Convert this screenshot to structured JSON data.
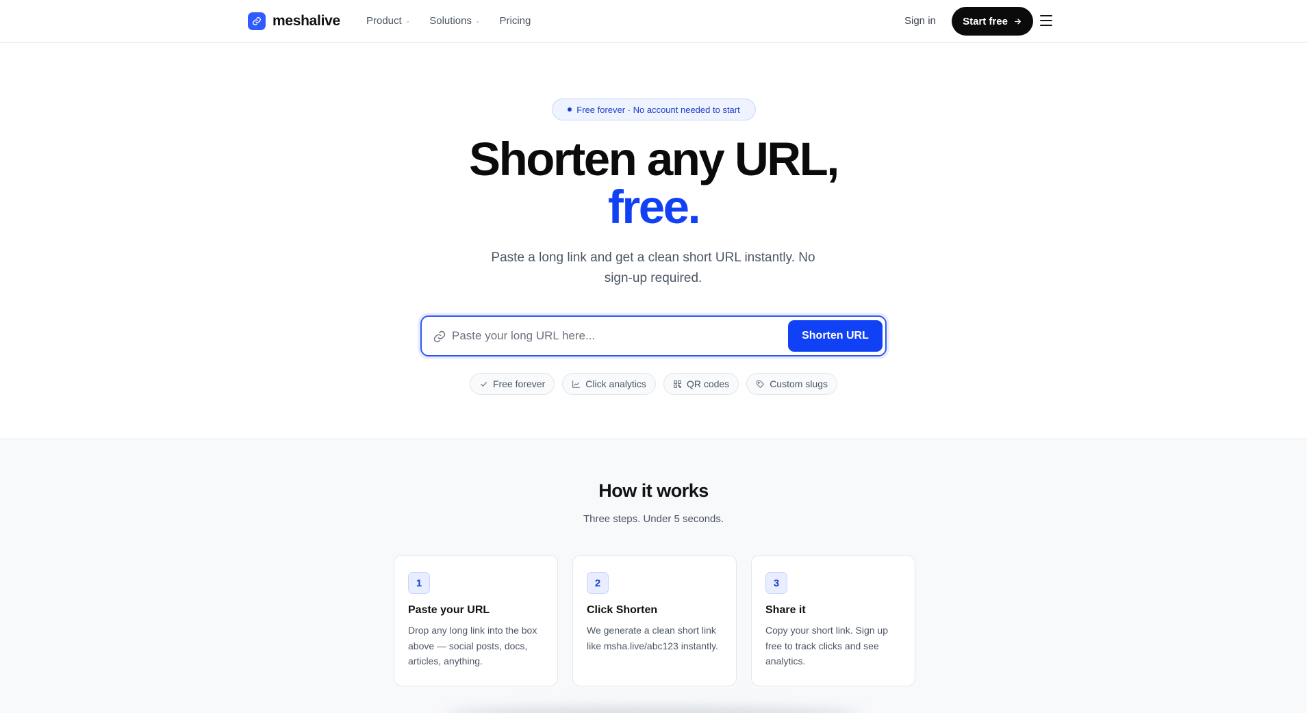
{
  "nav": {
    "brand": "meshalive",
    "links": [
      {
        "label": "Product",
        "has_dropdown": true
      },
      {
        "label": "Solutions",
        "has_dropdown": true
      },
      {
        "label": "Pricing",
        "has_dropdown": false
      }
    ],
    "signin": "Sign in",
    "start_button": "Start free"
  },
  "hero": {
    "badge": "Free forever · No account needed to start",
    "title_line1": "Shorten any URL,",
    "title_line2": "free.",
    "subtitle": "Paste a long link and get a clean short URL instantly. No sign-up required.",
    "input_placeholder": "Paste your long URL here...",
    "input_value": "",
    "submit_label": "Shorten URL",
    "chips": [
      {
        "label": "Free forever",
        "icon": "check-icon"
      },
      {
        "label": "Click analytics",
        "icon": "chart-icon"
      },
      {
        "label": "QR codes",
        "icon": "qr-icon"
      },
      {
        "label": "Custom slugs",
        "icon": "tag-icon"
      }
    ]
  },
  "how": {
    "title": "How it works",
    "subtitle": "Three steps. Under 5 seconds.",
    "steps": [
      {
        "num": "1",
        "title": "Paste your URL",
        "desc": "Drop any long link into the box above — social posts, docs, articles, anything."
      },
      {
        "num": "2",
        "title": "Click Shorten",
        "desc": "We generate a clean short link like msha.live/abc123 instantly."
      },
      {
        "num": "3",
        "title": "Share it",
        "desc": "Copy your short link. Sign up free to track clicks and see analytics."
      }
    ]
  },
  "colors": {
    "accent": "#1141f5",
    "dark": "#0b0b0b",
    "muted_text": "#4b5563",
    "section_bg": "#f8f9fb"
  }
}
